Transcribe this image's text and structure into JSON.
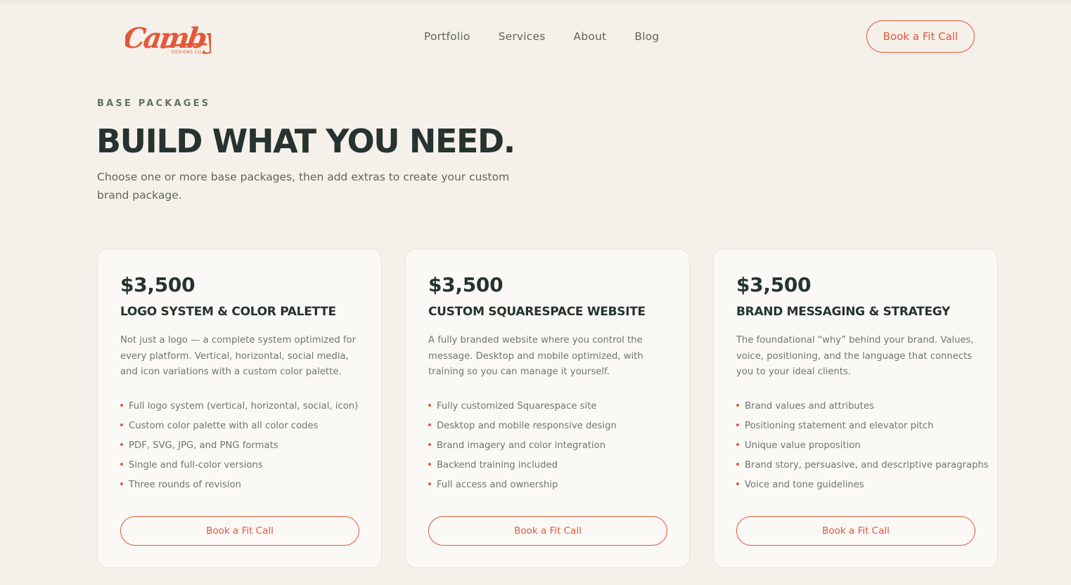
{
  "brand": {
    "logo_text": "Camby",
    "logo_subtext": "DESIGNS CO.",
    "accent_color": "#e4583a"
  },
  "nav": {
    "items": [
      {
        "label": "Portfolio"
      },
      {
        "label": "Services"
      },
      {
        "label": "About"
      },
      {
        "label": "Blog"
      }
    ],
    "cta_label": "Book a Fit Call"
  },
  "hero": {
    "eyebrow": "BASE PACKAGES",
    "title": "BUILD WHAT YOU NEED.",
    "intro": "Choose one or more base packages, then add extras to create your custom brand package."
  },
  "packages": [
    {
      "price": "$3,500",
      "title": "LOGO SYSTEM & COLOR PALETTE",
      "description": "Not just a logo — a complete system optimized for every platform. Vertical, horizontal, social media, and icon variations with a custom color palette.",
      "features": [
        "Full logo system (vertical, horizontal, social, icon)",
        "Custom color palette with all color codes",
        "PDF, SVG, JPG, and PNG formats",
        "Single and full-color versions",
        "Three rounds of revision"
      ],
      "cta_label": "Book a Fit Call"
    },
    {
      "price": "$3,500",
      "title": "CUSTOM SQUARESPACE WEBSITE",
      "description": "A fully branded website where you control the message. Desktop and mobile optimized, with training so you can manage it yourself.",
      "features": [
        "Fully customized Squarespace site",
        "Desktop and mobile responsive design",
        "Brand imagery and color integration",
        "Backend training included",
        "Full access and ownership"
      ],
      "cta_label": "Book a Fit Call"
    },
    {
      "price": "$3,500",
      "title": "BRAND MESSAGING & STRATEGY",
      "description": "The foundational “why” behind your brand. Values, voice, positioning, and the language that connects you to your ideal clients.",
      "features": [
        "Brand values and attributes",
        "Positioning statement and elevator pitch",
        "Unique value proposition",
        "Brand story, persuasive, and descriptive paragraphs",
        "Voice and tone guidelines"
      ],
      "cta_label": "Book a Fit Call"
    }
  ]
}
